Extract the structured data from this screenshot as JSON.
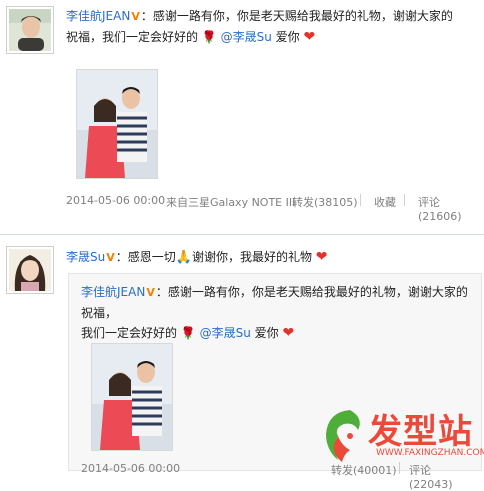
{
  "post1": {
    "username": "李佳航JEAN",
    "body_line1": "：感谢一路有你，你是老天赐给我最好的礼物，谢谢大家的",
    "body_line2_a": "祝福，我们一定会好好的",
    "mention": "@李晟Su",
    "body_line2_b": " 爱你",
    "timestamp": "2014-05-06 00:00",
    "source": "来自三星Galaxy NOTE III",
    "repost": "转发(38105)",
    "favorite": "收藏",
    "comment": "评论(21606)"
  },
  "post2": {
    "username": "李晟Su",
    "body": "：感恩一切",
    "body_after_icon": "谢谢你，我最好的礼物",
    "quoted": {
      "username": "李佳航JEAN",
      "line1": "：感谢一路有你，你是老天赐给我最好的礼物，谢谢大家的祝福，",
      "line2_a": "我们一定会好好的",
      "mention": "@李晟Su",
      "line2_b": " 爱你",
      "timestamp": "2014-05-06 00:00",
      "repost": "转发(40001)",
      "comment": "评论(22043)"
    }
  },
  "watermark": {
    "brand": "发型站",
    "url": "WWW.FAXINGZHAN.COM"
  },
  "colors": {
    "link": "#2a6ec8",
    "heart": "#e0342b",
    "watermark": "#ea4a3a"
  }
}
